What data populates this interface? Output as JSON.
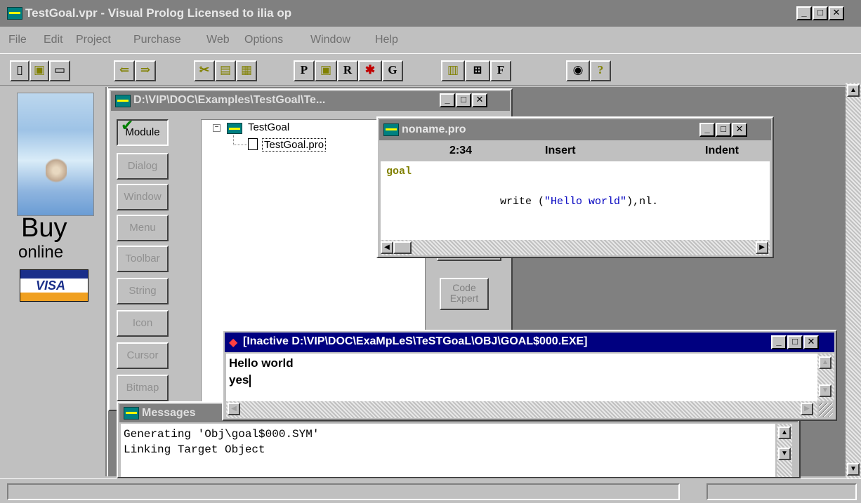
{
  "app": {
    "title": "TestGoal.vpr - Visual Prolog Licensed to ilia op",
    "window_controls": [
      "_",
      "□",
      "✕"
    ]
  },
  "menu": [
    "File",
    "Edit",
    "Project",
    "Purchase",
    "Web",
    "Options",
    "Window",
    "Help"
  ],
  "toolbar": {
    "r_label": "R",
    "g_label": "G",
    "f_label": "F",
    "help_label": "?"
  },
  "ad": {
    "buy": "Buy",
    "online": "online",
    "visa": "VISA"
  },
  "project_window": {
    "title": "D:\\VIP\\DOC\\Examples\\TestGoal\\Te...",
    "tabs": [
      "Module",
      "Dialog",
      "Window",
      "Menu",
      "Toolbar",
      "String",
      "Icon",
      "Cursor",
      "Bitmap"
    ],
    "tree_root": "TestGoal",
    "tree_child": "TestGoal.pro",
    "code_expert_line1": "Code",
    "code_expert_line2": "Expert"
  },
  "editor": {
    "title": "noname.pro",
    "position": "2:34",
    "mode": "Insert",
    "indent": "Indent",
    "keyword": "goal",
    "code_pre": "write (",
    "code_string": "\"Hello world\"",
    "code_post": "),nl."
  },
  "console": {
    "title": "[Inactive D:\\VIP\\DOC\\ExaMpLeS\\TeSTGoaL\\OBJ\\GOAL$000.EXE]",
    "line1": "Hello world",
    "line2": "yes"
  },
  "messages": {
    "title": "Messages",
    "line1": "Generating 'Obj\\goal$000.SYM'",
    "line2": "Linking Target Object"
  },
  "colors": {
    "desktop": "#808080",
    "face": "#c0c0c0",
    "active_title": "#000080",
    "inactive_title": "#808080",
    "keyword": "#808000",
    "string": "#0000c0"
  }
}
